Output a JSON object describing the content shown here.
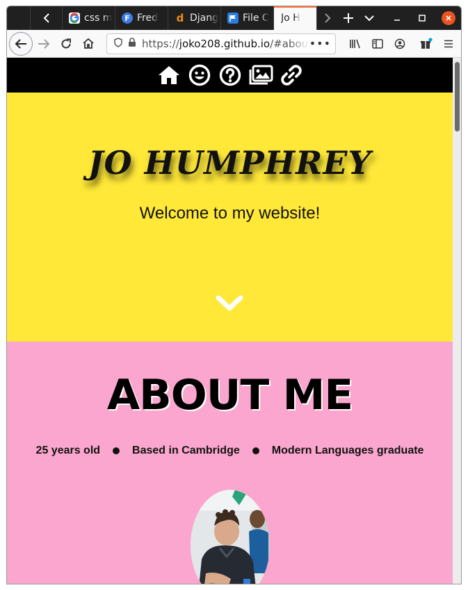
{
  "browser": {
    "tabs": [
      {
        "label": "css m",
        "favicon": "google-icon",
        "color": "#ffffff"
      },
      {
        "label": "Fred",
        "favicon": "F",
        "color": "#3c7be6"
      },
      {
        "label": "Djang",
        "favicon": "d",
        "color": "#f28b1d"
      },
      {
        "label": "File C",
        "favicon": "flag-icon",
        "color": "#2a7de1"
      },
      {
        "label": "Jo H",
        "active": true
      }
    ],
    "url": {
      "scheme": "https://",
      "host": "joko208.github.io",
      "path": "/#about-",
      "more": "•••"
    }
  },
  "site": {
    "nav_icons": [
      "home-icon",
      "smile-icon",
      "question-icon",
      "images-icon",
      "link-icon"
    ],
    "hero": {
      "name": "JO HUMPHREY",
      "welcome": "Welcome to my website!",
      "background": "#ffe838"
    },
    "about": {
      "title": "ABOUT ME",
      "facts": [
        "25 years old",
        "Based in Cambridge",
        "Modern Languages graduate"
      ],
      "background": "#fba6ce"
    }
  }
}
